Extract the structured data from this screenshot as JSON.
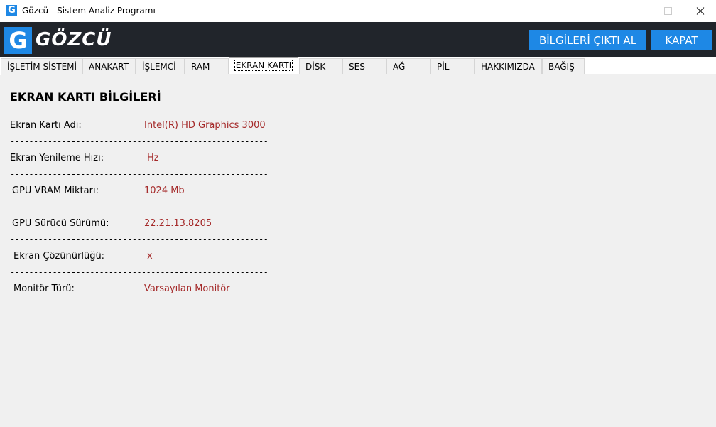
{
  "window": {
    "title": "Gözcü - Sistem Analiz Programı",
    "icon": "app-g-icon"
  },
  "header": {
    "logo_letter": "G",
    "logo_text": "GÖZCÜ",
    "print_button": "BİLGİLERİ ÇIKTI AL",
    "close_button": "KAPAT",
    "accent_color": "#1e88e5",
    "background_color": "#21252b"
  },
  "tabs": [
    {
      "label": "İŞLETİM SİSTEMİ"
    },
    {
      "label": "ANAKART"
    },
    {
      "label": "İŞLEMCİ"
    },
    {
      "label": "RAM"
    },
    {
      "label": "EKRAN KARTI",
      "active": true
    },
    {
      "label": "DİSK"
    },
    {
      "label": "SES"
    },
    {
      "label": "AĞ"
    },
    {
      "label": "PİL"
    },
    {
      "label": "HAKKIMIZDA"
    },
    {
      "label": "BAĞIŞ"
    }
  ],
  "section": {
    "title": "EKRAN KARTI BİLGİLERİ",
    "separator": "-------------------------------------------------------",
    "rows": [
      {
        "label": "Ekran Kartı Adı:",
        "value": "Intel(R) HD Graphics 3000"
      },
      {
        "label": "Ekran Yenileme Hızı:",
        "value": "Hz"
      },
      {
        "label": "GPU VRAM Miktarı:",
        "value": "1024 Mb"
      },
      {
        "label": "GPU Sürücü Sürümü:",
        "value": "22.21.13.8205"
      },
      {
        "label": "Ekran Çözünürlüğü:",
        "value": "x"
      },
      {
        "label": "Monitör Türü:",
        "value": "Varsayılan Monitör"
      }
    ],
    "value_color": "#a52a2a"
  }
}
